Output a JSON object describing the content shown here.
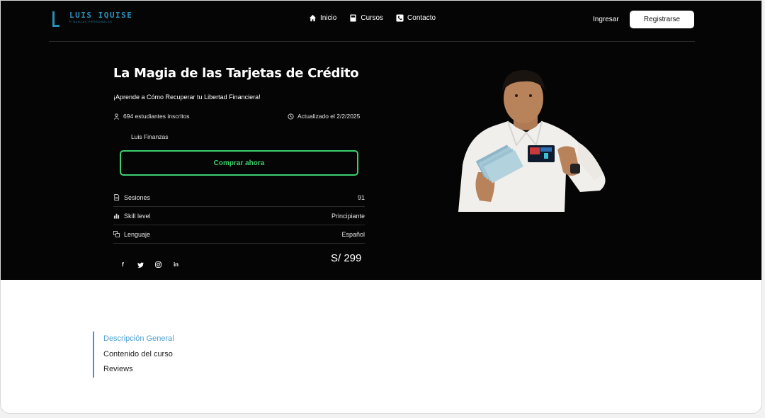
{
  "brand": {
    "name": "LUIS IQUISE",
    "tagline": "FINANZAS PERSONALES"
  },
  "nav": {
    "links": [
      {
        "label": "Inicio",
        "icon": "home-icon"
      },
      {
        "label": "Cursos",
        "icon": "book-icon"
      },
      {
        "label": "Contacto",
        "icon": "phone-icon"
      }
    ],
    "login_label": "Ingresar",
    "register_label": "Registrarse"
  },
  "course": {
    "title": "La Magia de las Tarjetas de Crédito",
    "subtitle": "¡Aprende a Cómo Recuperar tu Libertad Financiera!",
    "students": "694 estudiantes inscritos",
    "updated": "Actualizado el 2/2/2025",
    "author": "Luis Finanzas",
    "buy_label": "Comprar ahora",
    "specs": [
      {
        "label": "Sesiones",
        "value": "91",
        "icon": "document-icon"
      },
      {
        "label": "Skill level",
        "value": "Principiante",
        "icon": "bar-chart-icon"
      },
      {
        "label": "Lenguaje",
        "value": "Español",
        "icon": "language-icon"
      }
    ],
    "price": "S/ 299"
  },
  "socials": [
    {
      "label": "f",
      "icon": "facebook-icon"
    },
    {
      "label": "t",
      "icon": "twitter-icon"
    },
    {
      "label": "ig",
      "icon": "instagram-icon"
    },
    {
      "label": "in",
      "icon": "linkedin-icon"
    }
  ],
  "tabs": [
    {
      "label": "Descripción General",
      "active": true
    },
    {
      "label": "Contenido del curso",
      "active": false
    },
    {
      "label": "Reviews",
      "active": false
    }
  ],
  "colors": {
    "accent_green": "#3dcf6d",
    "accent_blue": "#4a9fd0",
    "brand_blue": "#2a8fb8",
    "hero_bg": "#050505"
  }
}
